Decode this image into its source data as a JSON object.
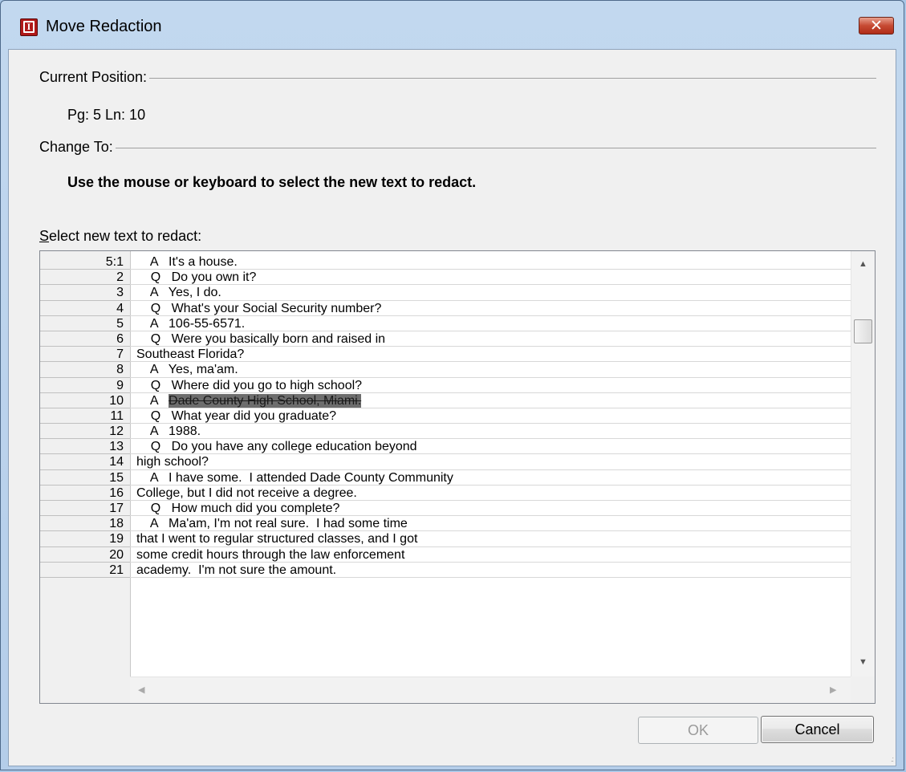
{
  "window": {
    "title": "Move Redaction",
    "close_symbol": "✕"
  },
  "current_position": {
    "label": "Current Position:",
    "value": "Pg: 5 Ln: 10"
  },
  "change_to": {
    "label": "Change To:",
    "instruction": "Use the mouse or keyboard to select the new text to redact."
  },
  "select_label": {
    "accesskey": "S",
    "rest": "elect new text to redact:"
  },
  "transcript": {
    "rows": [
      {
        "ln": "5:1",
        "text": "    A   It's a house."
      },
      {
        "ln": "2",
        "text": "    Q   Do you own it?"
      },
      {
        "ln": "3",
        "text": "    A   Yes, I do."
      },
      {
        "ln": "4",
        "text": "    Q   What's your Social Security number?"
      },
      {
        "ln": "5",
        "text": "    A   106-55-6571."
      },
      {
        "ln": "6",
        "text": "    Q   Were you basically born and raised in"
      },
      {
        "ln": "7",
        "text": "Southeast Florida?"
      },
      {
        "ln": "8",
        "text": "    A   Yes, ma'am."
      },
      {
        "ln": "9",
        "text": "    Q   Where did you go to high school?"
      },
      {
        "ln": "10",
        "prefix": "    A   ",
        "redacted": "Dade County High School, Miami."
      },
      {
        "ln": "11",
        "text": "    Q   What year did you graduate?"
      },
      {
        "ln": "12",
        "text": "    A   1988."
      },
      {
        "ln": "13",
        "text": "    Q   Do you have any college education beyond"
      },
      {
        "ln": "14",
        "text": "high school?"
      },
      {
        "ln": "15",
        "text": "    A   I have some.  I attended Dade County Community"
      },
      {
        "ln": "16",
        "text": "College, but I did not receive a degree."
      },
      {
        "ln": "17",
        "text": "    Q   How much did you complete?"
      },
      {
        "ln": "18",
        "text": "    A   Ma'am, I'm not real sure.  I had some time"
      },
      {
        "ln": "19",
        "text": "that I went to regular structured classes, and I got"
      },
      {
        "ln": "20",
        "text": "some credit hours through the law enforcement"
      },
      {
        "ln": "21",
        "text": "academy.  I'm not sure the amount."
      }
    ]
  },
  "scroll": {
    "up": "▲",
    "down": "▼",
    "left": "◀",
    "right": "▶"
  },
  "buttons": {
    "ok": "OK",
    "cancel": "Cancel"
  },
  "icons": {
    "app": "app-logo-icon",
    "grip": "resize-grip-icon"
  }
}
